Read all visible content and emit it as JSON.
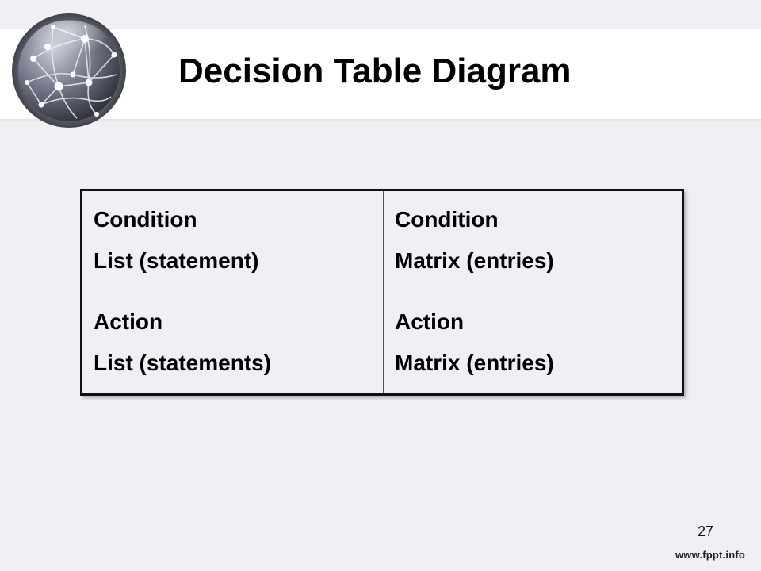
{
  "slide": {
    "title": "Decision Table Diagram",
    "page_number": "27",
    "footer_url": "www.fppt.info",
    "logo_icon": "network-globe-icon"
  },
  "table": {
    "rows": [
      {
        "cells": [
          {
            "line1": "Condition",
            "line2": "List (statement)"
          },
          {
            "line1": "Condition",
            "line2": "Matrix (entries)"
          }
        ]
      },
      {
        "cells": [
          {
            "line1": "Action",
            "line2": "List (statements)"
          },
          {
            "line1": "Action",
            "line2": "Matrix (entries)"
          }
        ]
      }
    ]
  }
}
